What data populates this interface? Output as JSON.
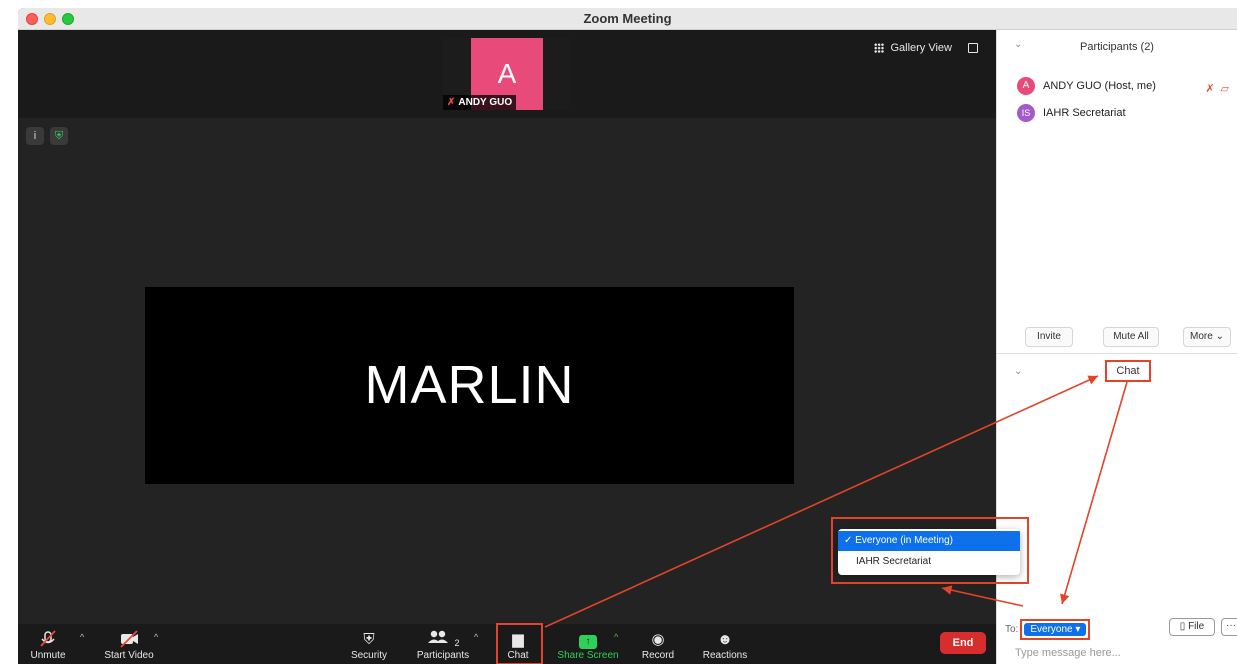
{
  "window": {
    "title": "Zoom Meeting"
  },
  "video": {
    "thumbnail_name": "ANDY GUO",
    "thumbnail_avatar_letter": "A",
    "main_tile_name": "MARLIN",
    "gallery_view_label": "Gallery View"
  },
  "toolbar": {
    "unmute": "Unmute",
    "start_video": "Start Video",
    "security": "Security",
    "participants": "Participants",
    "participants_count": "2",
    "chat": "Chat",
    "share_screen": "Share Screen",
    "record": "Record",
    "reactions": "Reactions",
    "end": "End"
  },
  "participants_panel": {
    "title": "Participants (2)",
    "participants": [
      {
        "initials": "A",
        "name": "ANDY GUO (Host, me)"
      },
      {
        "initials": "IS",
        "name": "IAHR Secretariat"
      }
    ],
    "invite": "Invite",
    "mute_all": "Mute All",
    "more": "More"
  },
  "chat_panel": {
    "title": "Chat",
    "to_label": "To:",
    "recipient": "Everyone",
    "file_button": "File",
    "more_button": "···",
    "input_placeholder": "Type message here..."
  },
  "recipient_dropdown": {
    "options": [
      "Everyone (in Meeting)",
      "IAHR Secretariat"
    ],
    "selected_index": 0
  },
  "colors": {
    "annotation": "#e2442a",
    "accent_blue": "#0e71eb",
    "end_red": "#d72d2d",
    "share_green": "#2fd05a"
  }
}
